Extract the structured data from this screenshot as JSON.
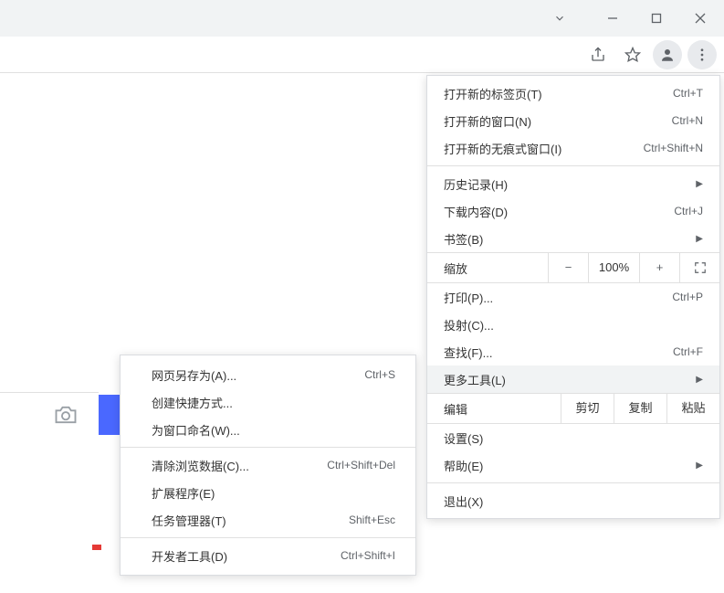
{
  "window_controls": {
    "dropdown": "⌄",
    "minimize": "—",
    "maximize": "▢",
    "close": "✕"
  },
  "toolbar_icons": {
    "share": "share-icon",
    "star": "star-icon",
    "profile": "profile-icon",
    "menu": "menu-icon"
  },
  "main_menu": {
    "new_tab": {
      "label": "打开新的标签页(T)",
      "shortcut": "Ctrl+T"
    },
    "new_window": {
      "label": "打开新的窗口(N)",
      "shortcut": "Ctrl+N"
    },
    "incognito": {
      "label": "打开新的无痕式窗口(I)",
      "shortcut": "Ctrl+Shift+N"
    },
    "history": {
      "label": "历史记录(H)"
    },
    "downloads": {
      "label": "下载内容(D)",
      "shortcut": "Ctrl+J"
    },
    "bookmarks": {
      "label": "书签(B)"
    },
    "zoom": {
      "label": "缩放",
      "value": "100%",
      "minus": "−",
      "plus": "+"
    },
    "print": {
      "label": "打印(P)...",
      "shortcut": "Ctrl+P"
    },
    "cast": {
      "label": "投射(C)..."
    },
    "find": {
      "label": "查找(F)...",
      "shortcut": "Ctrl+F"
    },
    "more_tools": {
      "label": "更多工具(L)"
    },
    "edit": {
      "label": "编辑",
      "cut": "剪切",
      "copy": "复制",
      "paste": "粘贴"
    },
    "settings": {
      "label": "设置(S)"
    },
    "help": {
      "label": "帮助(E)"
    },
    "exit": {
      "label": "退出(X)"
    }
  },
  "submenu": {
    "save_as": {
      "label": "网页另存为(A)...",
      "shortcut": "Ctrl+S"
    },
    "create_shortcut": {
      "label": "创建快捷方式..."
    },
    "name_window": {
      "label": "为窗口命名(W)..."
    },
    "clear_data": {
      "label": "清除浏览数据(C)...",
      "shortcut": "Ctrl+Shift+Del"
    },
    "extensions": {
      "label": "扩展程序(E)"
    },
    "task_manager": {
      "label": "任务管理器(T)",
      "shortcut": "Shift+Esc"
    },
    "dev_tools": {
      "label": "开发者工具(D)",
      "shortcut": "Ctrl+Shift+I"
    }
  }
}
